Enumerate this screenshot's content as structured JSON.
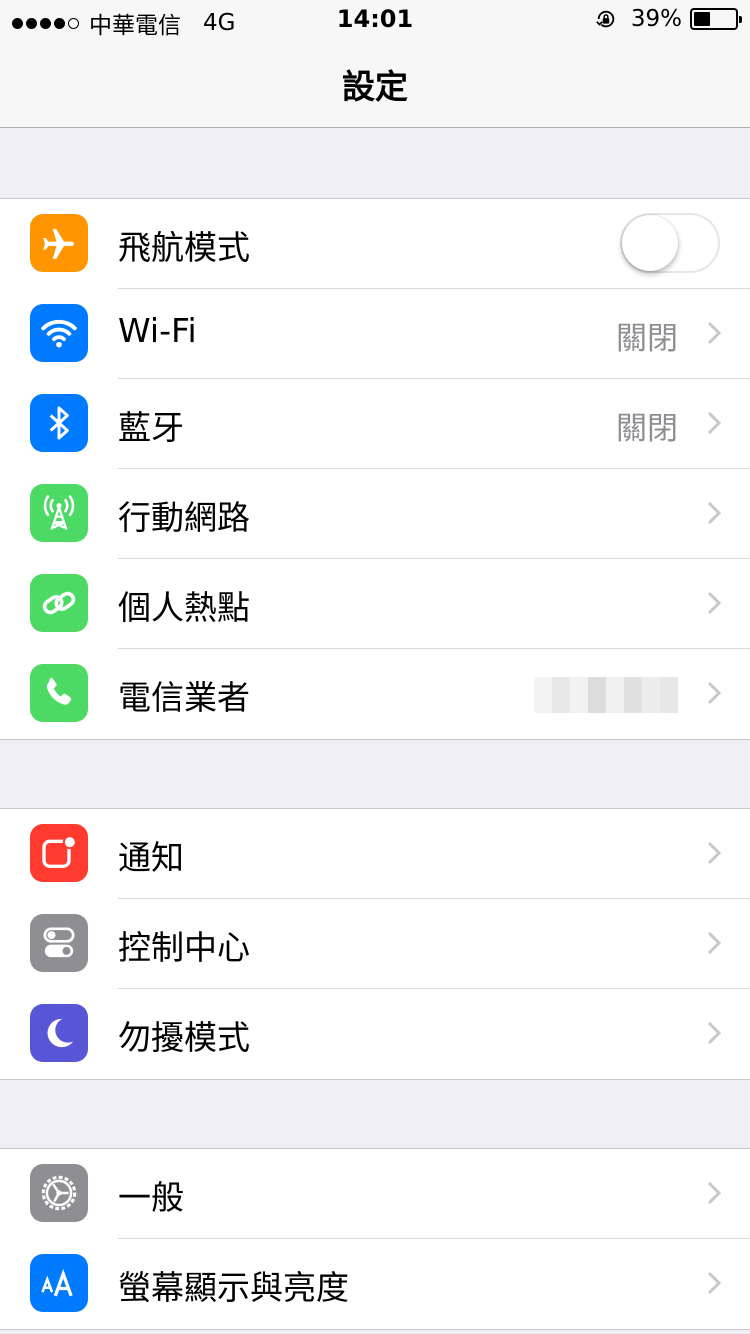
{
  "status_bar": {
    "signal_dots": 5,
    "signal_filled": 4,
    "carrier": "中華電信",
    "network": "4G",
    "time": "14:01",
    "battery_percent": "39%",
    "battery_level": 0.39
  },
  "nav": {
    "title": "設定"
  },
  "groups": [
    {
      "rows": [
        {
          "label": "飛航模式",
          "icon": "airplane-icon",
          "icon_bg": "#ff9500",
          "control": "toggle",
          "toggle_on": false
        },
        {
          "label": "Wi-Fi",
          "icon": "wifi-icon",
          "icon_bg": "#007aff",
          "value": "關閉"
        },
        {
          "label": "藍牙",
          "icon": "bluetooth-icon",
          "icon_bg": "#007aff",
          "value": "關閉"
        },
        {
          "label": "行動網路",
          "icon": "cellular-antenna-icon",
          "icon_bg": "#4cd964"
        },
        {
          "label": "個人熱點",
          "icon": "hotspot-chain-icon",
          "icon_bg": "#4cd964"
        },
        {
          "label": "電信業者",
          "icon": "phone-icon",
          "icon_bg": "#4cd964",
          "value_obscured": true
        }
      ]
    },
    {
      "rows": [
        {
          "label": "通知",
          "icon": "notifications-icon",
          "icon_bg": "#ff3b30"
        },
        {
          "label": "控制中心",
          "icon": "control-center-icon",
          "icon_bg": "#8e8e93"
        },
        {
          "label": "勿擾模式",
          "icon": "moon-icon",
          "icon_bg": "#5856d6"
        }
      ]
    },
    {
      "rows": [
        {
          "label": "一般",
          "icon": "gear-icon",
          "icon_bg": "#8e8e93"
        },
        {
          "label": "螢幕顯示與亮度",
          "icon": "text-size-icon",
          "icon_bg": "#007aff"
        }
      ]
    }
  ]
}
